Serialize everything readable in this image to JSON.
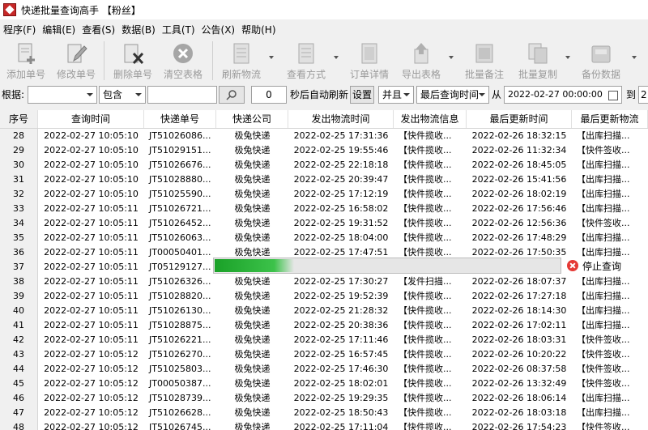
{
  "window": {
    "title": "快递批量查询高手 【粉丝】"
  },
  "menu": [
    "程序(F)",
    "编辑(E)",
    "查看(S)",
    "数据(B)",
    "工具(T)",
    "公告(X)",
    "帮助(H)"
  ],
  "toolbar": {
    "items": [
      {
        "label": "添加单号",
        "icon": "add-document-icon"
      },
      {
        "label": "修改单号",
        "icon": "edit-pencil-icon"
      },
      {
        "label": "删除单号",
        "icon": "delete-x-icon"
      },
      {
        "label": "清空表格",
        "icon": "clear-circle-x-icon"
      },
      {
        "label": "刷新物流",
        "icon": "refresh-icon"
      },
      {
        "label": "查看方式",
        "icon": "view-mode-icon"
      },
      {
        "label": "订单详情",
        "icon": "order-detail-icon"
      },
      {
        "label": "导出表格",
        "icon": "export-icon"
      },
      {
        "label": "批量备注",
        "icon": "note-icon"
      },
      {
        "label": "批量复制",
        "icon": "copy-icon"
      },
      {
        "label": "备份数据",
        "icon": "backup-icon"
      }
    ]
  },
  "filter": {
    "basis_label": "根据:",
    "basis_value": "",
    "match_value": "包含",
    "keyword_value": "",
    "seconds_value": "0",
    "auto_refresh_label": "秒后自动刷新",
    "settings_button": "设置",
    "logic_value": "并且",
    "field_value": "最后查询时间",
    "from_label": "从",
    "from_date": "2022-02-27 00:00:00",
    "to_label": "到",
    "to_date_partial": "2"
  },
  "table": {
    "columns": [
      "序号",
      "查询时间",
      "快递单号",
      "快递公司",
      "发出物流时间",
      "发出物流信息",
      "最后更新时间",
      "最后更新物流"
    ],
    "rows": [
      [
        "28",
        "2022-02-27 10:05:10",
        "JT51026086...",
        "极兔快递",
        "2022-02-25 17:31:36",
        "【快件揽收...",
        "2022-02-26 18:32:15",
        "【出库扫描..."
      ],
      [
        "29",
        "2022-02-27 10:05:10",
        "JT51029151...",
        "极兔快递",
        "2022-02-25 19:55:46",
        "【快件揽收...",
        "2022-02-26 11:32:34",
        "【快件签收..."
      ],
      [
        "30",
        "2022-02-27 10:05:10",
        "JT51026676...",
        "极兔快递",
        "2022-02-25 22:18:18",
        "【快件揽收...",
        "2022-02-26 18:45:05",
        "【出库扫描..."
      ],
      [
        "31",
        "2022-02-27 10:05:10",
        "JT51028880...",
        "极兔快递",
        "2022-02-25 20:39:47",
        "【快件揽收...",
        "2022-02-26 15:41:56",
        "【出库扫描..."
      ],
      [
        "32",
        "2022-02-27 10:05:10",
        "JT51025590...",
        "极兔快递",
        "2022-02-25 17:12:19",
        "【快件揽收...",
        "2022-02-26 18:02:19",
        "【出库扫描..."
      ],
      [
        "33",
        "2022-02-27 10:05:11",
        "JT51026721...",
        "极兔快递",
        "2022-02-25 16:58:02",
        "【快件揽收...",
        "2022-02-26 17:56:46",
        "【出库扫描..."
      ],
      [
        "34",
        "2022-02-27 10:05:11",
        "JT51026452...",
        "极兔快递",
        "2022-02-25 19:31:52",
        "【快件揽收...",
        "2022-02-26 12:56:36",
        "【快件签收..."
      ],
      [
        "35",
        "2022-02-27 10:05:11",
        "JT51026063...",
        "极兔快递",
        "2022-02-25 18:04:00",
        "【快件揽收...",
        "2022-02-26 17:48:29",
        "【出库扫描..."
      ],
      [
        "36",
        "2022-02-27 10:05:11",
        "JT00050401...",
        "极兔快递",
        "2022-02-25 17:47:51",
        "【快件揽收...",
        "2022-02-26 17:50:35",
        "【出库扫描..."
      ],
      [
        "37",
        "2022-02-27 10:05:11",
        "JT05129127...",
        "",
        "",
        "",
        "",
        ""
      ],
      [
        "38",
        "2022-02-27 10:05:11",
        "JT51026326...",
        "极兔快递",
        "2022-02-25 17:30:27",
        "【发件扫描...",
        "2022-02-26 18:07:37",
        "【出库扫描..."
      ],
      [
        "39",
        "2022-02-27 10:05:11",
        "JT51028820...",
        "极兔快递",
        "2022-02-25 19:52:39",
        "【快件揽收...",
        "2022-02-26 17:27:18",
        "【出库扫描..."
      ],
      [
        "40",
        "2022-02-27 10:05:11",
        "JT51026130...",
        "极兔快递",
        "2022-02-25 21:28:32",
        "【快件揽收...",
        "2022-02-26 18:14:30",
        "【出库扫描..."
      ],
      [
        "41",
        "2022-02-27 10:05:11",
        "JT51028875...",
        "极兔快递",
        "2022-02-25 20:38:36",
        "【快件揽收...",
        "2022-02-26 17:02:11",
        "【出库扫描..."
      ],
      [
        "42",
        "2022-02-27 10:05:11",
        "JT51026221...",
        "极兔快递",
        "2022-02-25 17:11:46",
        "【快件揽收...",
        "2022-02-26 18:03:31",
        "【快件签收..."
      ],
      [
        "43",
        "2022-02-27 10:05:12",
        "JT51026270...",
        "极兔快递",
        "2022-02-25 16:57:45",
        "【快件揽收...",
        "2022-02-26 10:20:22",
        "【快件签收..."
      ],
      [
        "44",
        "2022-02-27 10:05:12",
        "JT51025803...",
        "极兔快递",
        "2022-02-25 17:46:30",
        "【快件揽收...",
        "2022-02-26 08:37:58",
        "【快件签收..."
      ],
      [
        "45",
        "2022-02-27 10:05:12",
        "JT00050387...",
        "极兔快递",
        "2022-02-25 18:02:01",
        "【快件揽收...",
        "2022-02-26 13:32:49",
        "【快件签收..."
      ],
      [
        "46",
        "2022-02-27 10:05:12",
        "JT51028739...",
        "极兔快递",
        "2022-02-25 19:29:35",
        "【快件揽收...",
        "2022-02-26 18:06:14",
        "【出库扫描..."
      ],
      [
        "47",
        "2022-02-27 10:05:12",
        "JT51026628...",
        "极兔快递",
        "2022-02-25 18:50:43",
        "【快件揽收...",
        "2022-02-26 18:03:18",
        "【出库扫描..."
      ],
      [
        "48",
        "2022-02-27 10:05:12",
        "JT51026745...",
        "极兔快递",
        "2022-02-25 17:11:04",
        "【快件揽收...",
        "2022-02-26 17:54:23",
        "【快件签收..."
      ]
    ]
  },
  "progress": {
    "fraction": 0.23,
    "stop_label": "停止查询",
    "fill_color": "#22a830"
  }
}
